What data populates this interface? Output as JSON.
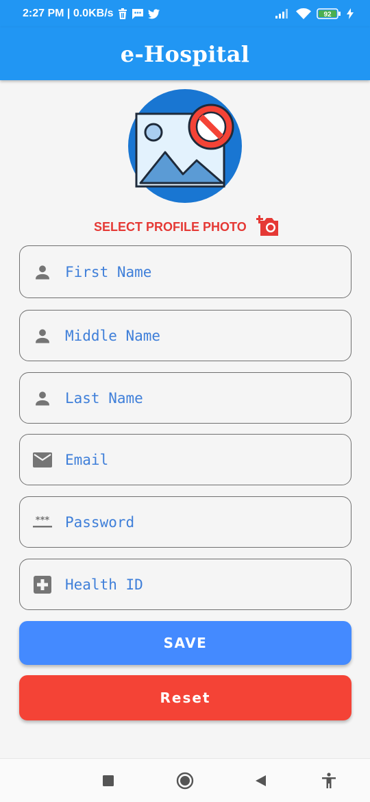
{
  "status_bar": {
    "time_speed": "2:27 PM | 0.0KB/s",
    "battery": "92",
    "icons": [
      "trash-icon",
      "message-icon",
      "twitter-icon",
      "signal-icon",
      "wifi-icon",
      "battery-icon",
      "charging-icon"
    ]
  },
  "app_bar": {
    "title": "e-Hospital"
  },
  "profile": {
    "select_photo_label": "SELECT PROFILE PHOTO"
  },
  "fields": [
    {
      "placeholder": "First Name",
      "icon": "person-icon"
    },
    {
      "placeholder": "Middle Name",
      "icon": "person-icon"
    },
    {
      "placeholder": "Last Name",
      "icon": "person-icon"
    },
    {
      "placeholder": "Email",
      "icon": "email-icon"
    },
    {
      "placeholder": "Password",
      "icon": "password-icon"
    },
    {
      "placeholder": "Health ID",
      "icon": "medical-cross-icon"
    }
  ],
  "buttons": {
    "save": "SAVE",
    "reset": "Reset"
  },
  "nav": {
    "icons": [
      "recents-icon",
      "home-icon",
      "back-icon",
      "accessibility-icon"
    ]
  },
  "colors": {
    "primary": "#2196f3",
    "save": "#448aff",
    "reset": "#f44336",
    "accent_text": "#e53935",
    "placeholder": "#3f7fd9"
  }
}
